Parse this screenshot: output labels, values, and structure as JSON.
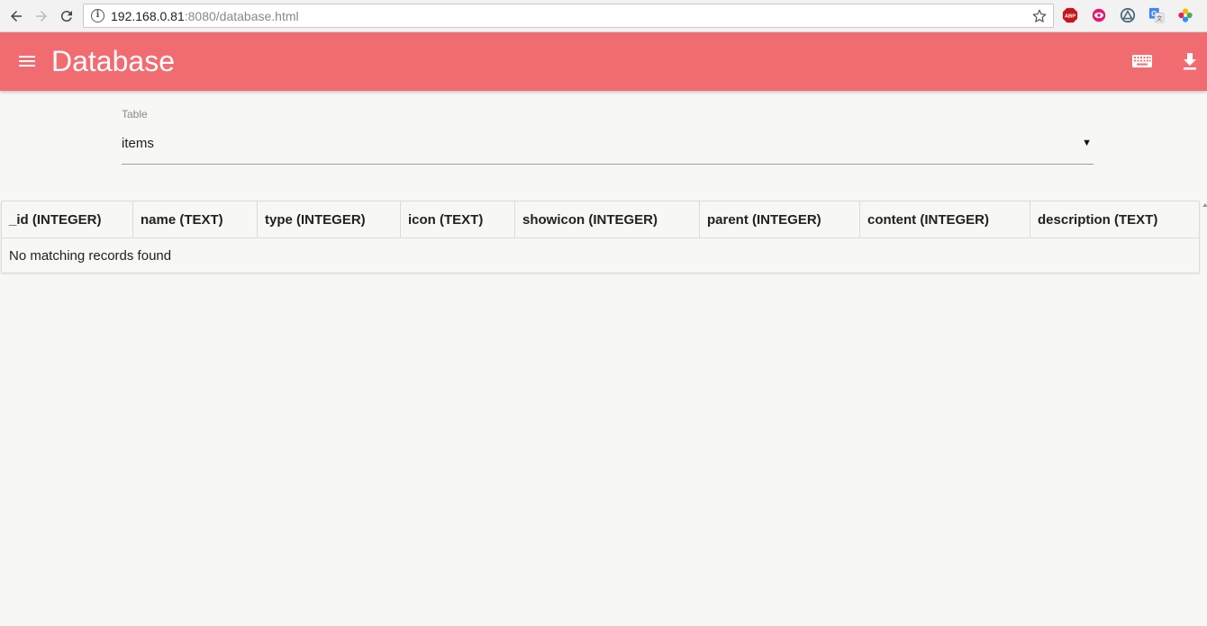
{
  "browser": {
    "url_host": "192.168.0.81",
    "url_rest": ":8080/database.html",
    "extensions": [
      "abp-icon",
      "eye-extension-icon",
      "triangle-extension-icon",
      "translate-icon",
      "flower-extension-icon"
    ]
  },
  "header": {
    "title": "Database",
    "accent_color": "#f16c71"
  },
  "table_select": {
    "label": "Table",
    "value": "items"
  },
  "table": {
    "columns": [
      "_id (INTEGER)",
      "name (TEXT)",
      "type (INTEGER)",
      "icon (TEXT)",
      "showicon (INTEGER)",
      "parent (INTEGER)",
      "content (INTEGER)",
      "description (TEXT)"
    ],
    "empty_message": "No matching records found"
  }
}
